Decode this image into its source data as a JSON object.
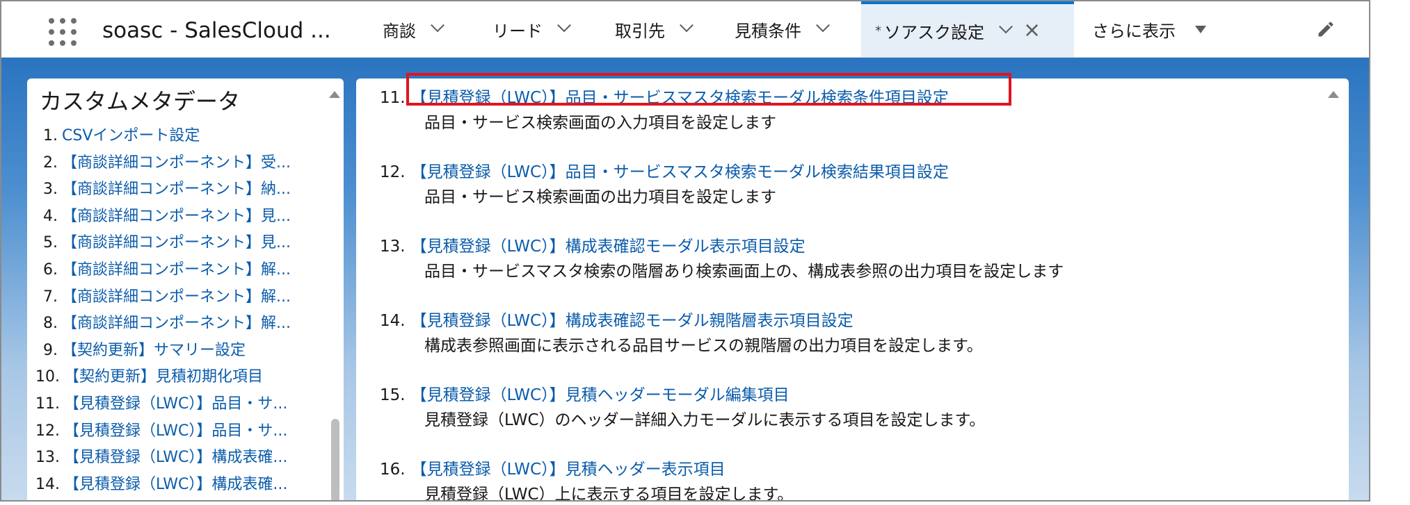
{
  "nav": {
    "app_name": "soasc - SalesCloud ...",
    "tabs": [
      {
        "label": "商談"
      },
      {
        "label": "リード"
      },
      {
        "label": "取引先"
      },
      {
        "label": "見積条件"
      },
      {
        "label": "ソアスク設定",
        "modified_marker": "*",
        "active": true
      },
      {
        "label": "さらに表示"
      }
    ]
  },
  "left_panel": {
    "title": "カスタムメタデータ",
    "items": [
      {
        "num": "1.",
        "label": "CSVインポート設定"
      },
      {
        "num": "2.",
        "label": "【商談詳細コンポーネント】受..."
      },
      {
        "num": "3.",
        "label": "【商談詳細コンポーネント】納..."
      },
      {
        "num": "4.",
        "label": "【商談詳細コンポーネント】見..."
      },
      {
        "num": "5.",
        "label": "【商談詳細コンポーネント】見..."
      },
      {
        "num": "6.",
        "label": "【商談詳細コンポーネント】解..."
      },
      {
        "num": "7.",
        "label": "【商談詳細コンポーネント】解..."
      },
      {
        "num": "8.",
        "label": "【商談詳細コンポーネント】解..."
      },
      {
        "num": "9.",
        "label": "【契約更新】サマリー設定"
      },
      {
        "num": "10.",
        "label": "【契約更新】見積初期化項目"
      },
      {
        "num": "11.",
        "label": "【見積登録（LWC）】品目・サ..."
      },
      {
        "num": "12.",
        "label": "【見積登録（LWC）】品目・サ..."
      },
      {
        "num": "13.",
        "label": "【見積登録（LWC）】構成表確..."
      },
      {
        "num": "14.",
        "label": "【見積登録（LWC）】構成表確..."
      }
    ]
  },
  "main": {
    "entries": [
      {
        "num": "11.",
        "title": "【見積登録（LWC）】品目・サービスマスタ検索モーダル検索条件項目設定",
        "desc": "品目・サービス検索画面の入力項目を設定します"
      },
      {
        "num": "12.",
        "title": "【見積登録（LWC）】品目・サービスマスタ検索モーダル検索結果項目設定",
        "desc": "品目・サービス検索画面の出力項目を設定します"
      },
      {
        "num": "13.",
        "title": "【見積登録（LWC）】構成表確認モーダル表示項目設定",
        "desc": "品目・サービスマスタ検索の階層あり検索画面上の、構成表参照の出力項目を設定します"
      },
      {
        "num": "14.",
        "title": "【見積登録（LWC）】構成表確認モーダル親階層表示項目設定",
        "desc": "構成表参照画面に表示される品目サービスの親階層の出力項目を設定します。"
      },
      {
        "num": "15.",
        "title": "【見積登録（LWC）】見積ヘッダーモーダル編集項目",
        "desc": "見積登録（LWC）のヘッダー詳細入力モーダルに表示する項目を設定します。"
      },
      {
        "num": "16.",
        "title": "【見積登録（LWC）】見積ヘッダー表示項目",
        "desc": "見積登録（LWC）上に表示する項目を設定します。"
      }
    ]
  },
  "colors": {
    "link": "#0b5cab",
    "active_tab_bg": "#e6eef7",
    "highlight_border": "#e0141e",
    "brand_band": "#2a74c0"
  },
  "icons": [
    "app-launcher-icon",
    "chevron-down-icon",
    "close-icon",
    "caret-down-icon",
    "pencil-icon",
    "scroll-up-icon"
  ]
}
